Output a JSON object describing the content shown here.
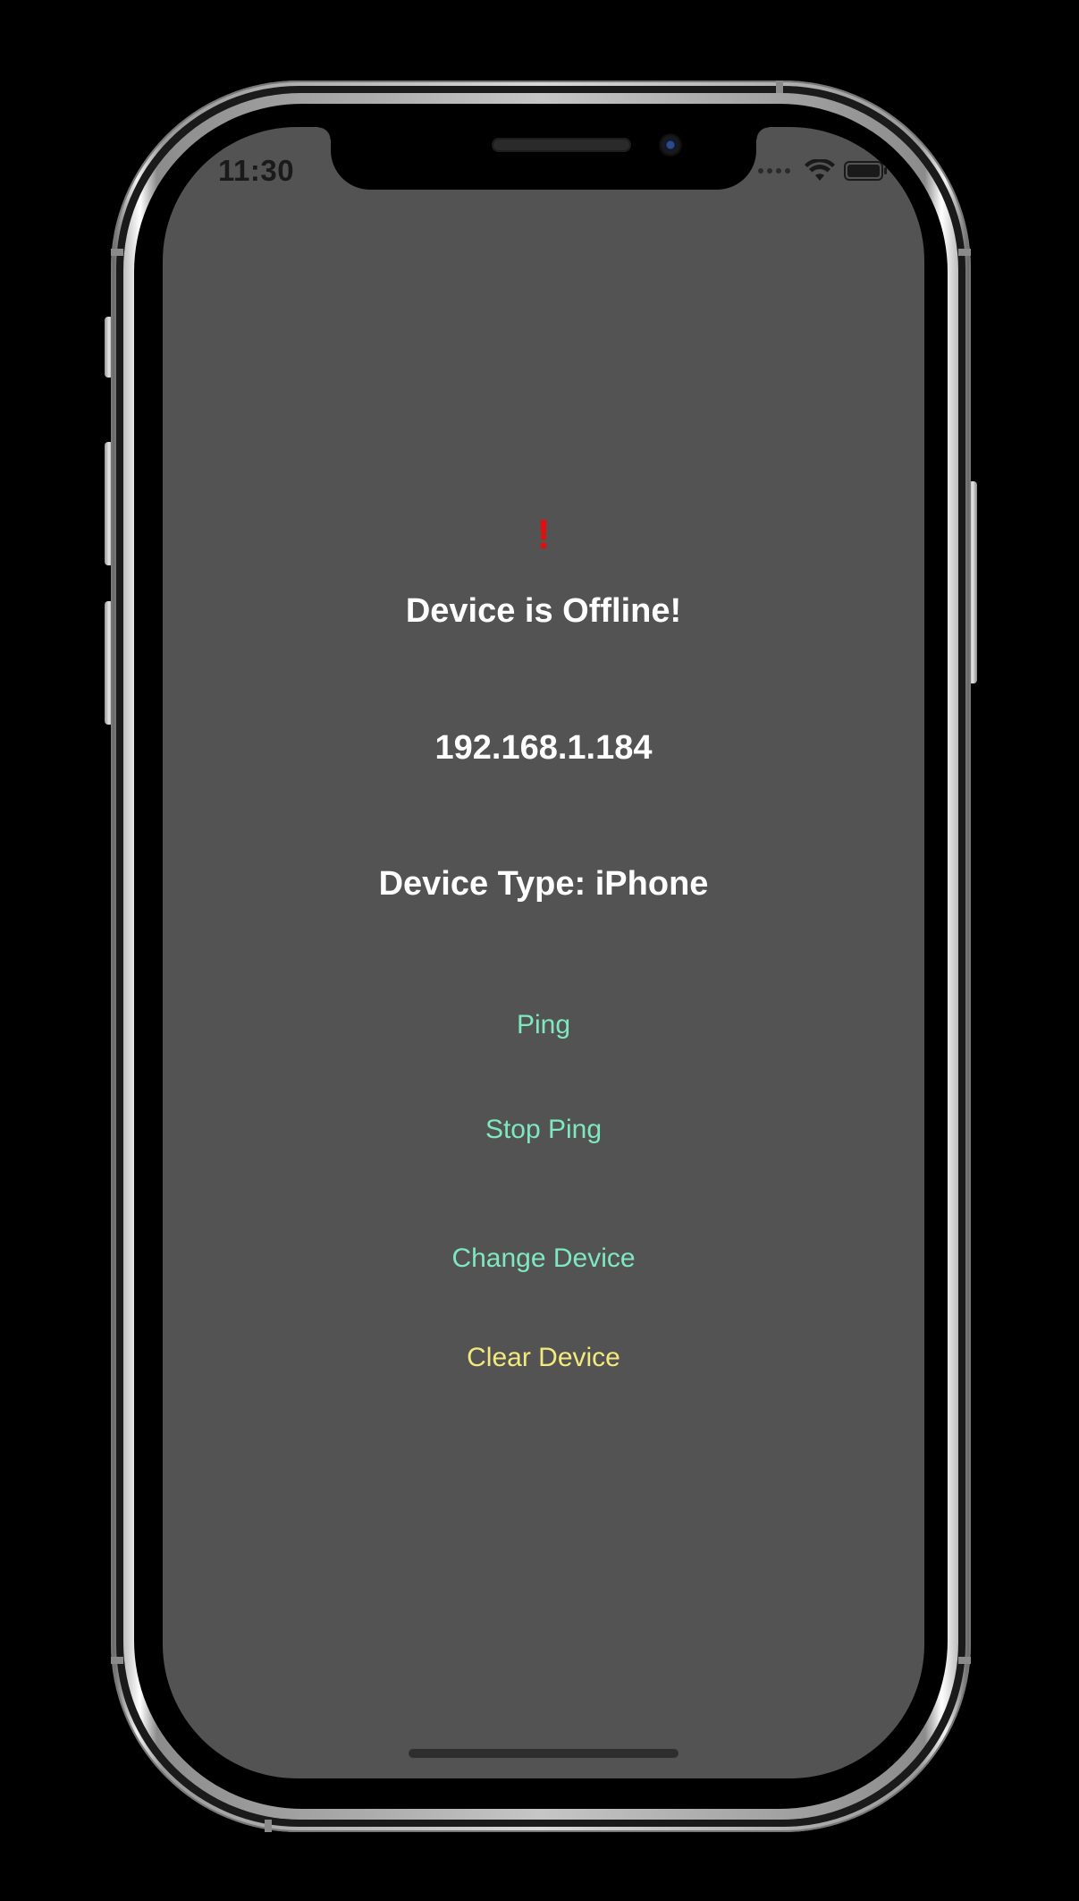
{
  "status_bar": {
    "time": "11:30",
    "icons": [
      "cellular-dots-icon",
      "wifi-icon",
      "battery-icon"
    ]
  },
  "main": {
    "alert_icon": "!",
    "status_text": "Device is Offline!",
    "ip_address": "192.168.1.184",
    "device_type": "Device Type: iPhone"
  },
  "actions": {
    "ping_label": "Ping",
    "stop_ping_label": "Stop Ping",
    "change_device_label": "Change Device",
    "clear_device_label": "Clear Device"
  },
  "colors": {
    "screen_background": "#535353",
    "alert": "#e20f0f",
    "primary_text": "#ffffff",
    "action_text": "#7ee8c0",
    "clear_action_text": "#f3e97c"
  }
}
